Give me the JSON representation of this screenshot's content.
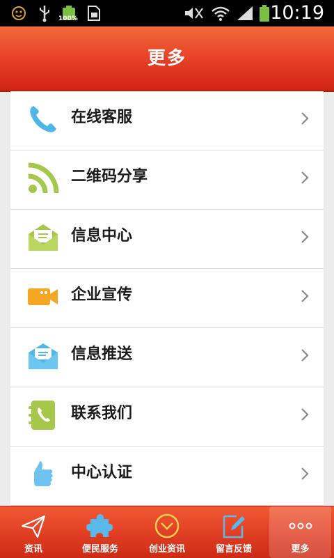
{
  "status_bar": {
    "time": "10:19",
    "battery_percent": "100%",
    "icons": [
      "emoji-icon",
      "usb-icon",
      "battery-icon",
      "sim-icon",
      "mute-icon",
      "wifi-icon",
      "signal-icon",
      "battery-full-icon"
    ]
  },
  "header": {
    "title": "更多"
  },
  "menu": {
    "items": [
      {
        "label": "在线客服",
        "icon": "phone-icon",
        "color": "#4fb6e8"
      },
      {
        "label": "二维码分享",
        "icon": "rss-icon",
        "color": "#a6c84a"
      },
      {
        "label": "信息中心",
        "icon": "envelope-open-icon",
        "color": "#a6c84a"
      },
      {
        "label": "企业宣传",
        "icon": "video-camera-icon",
        "color": "#f5a623"
      },
      {
        "label": "信息推送",
        "icon": "envelope-icon",
        "color": "#4fb6e8"
      },
      {
        "label": "联系我们",
        "icon": "contact-book-icon",
        "color": "#a6c84a"
      },
      {
        "label": "中心认证",
        "icon": "thumbs-up-icon",
        "color": "#6ec3ee"
      }
    ]
  },
  "tabbar": {
    "tabs": [
      {
        "label": "资讯",
        "icon": "paper-plane-icon"
      },
      {
        "label": "便民服务",
        "icon": "puzzle-icon"
      },
      {
        "label": "创业资讯",
        "icon": "compass-icon"
      },
      {
        "label": "留言反馈",
        "icon": "edit-icon"
      },
      {
        "label": "更多",
        "icon": "more-dots-icon",
        "active": true
      }
    ]
  },
  "colors": {
    "header": "#e8452a",
    "tabbar": "#e24025",
    "text": "#1a1a1a"
  }
}
